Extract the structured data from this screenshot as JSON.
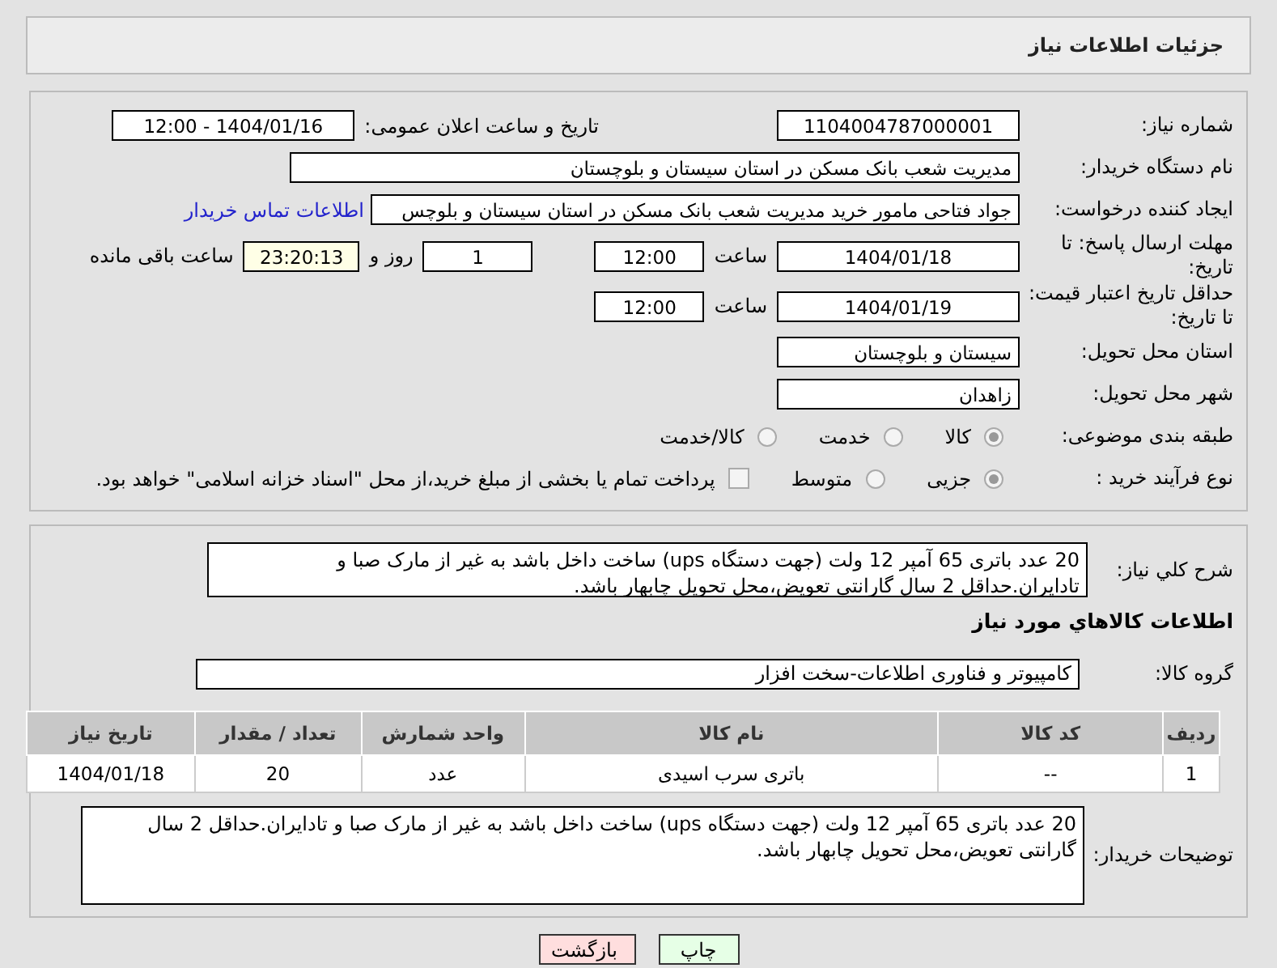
{
  "header": {
    "title": "جزئیات اطلاعات نیاز"
  },
  "details": {
    "need_number": {
      "label": "شماره نیاز:",
      "value": "1104004787000001"
    },
    "announce": {
      "label": "تاریخ و ساعت اعلان عمومی:",
      "value": "1404/01/16 - 12:00"
    },
    "buyer_org": {
      "label": "نام دستگاه خریدار:",
      "value": "مدیریت شعب بانک مسکن در استان سیستان و بلوچستان"
    },
    "requester": {
      "label": "ایجاد کننده درخواست:",
      "value": "جواد  فتاحی مامور خرید مدیریت شعب بانک مسکن در استان سیستان و بلوچس",
      "link": "اطلاعات تماس خریدار"
    },
    "reply_deadline": {
      "label": "مهلت ارسال پاسخ: تا تاریخ:",
      "date": "1404/01/18",
      "time_label": "ساعت",
      "time": "12:00",
      "days": "1",
      "days_label": "روز و",
      "remaining": "23:20:13",
      "remaining_label": "ساعت باقی مانده"
    },
    "price_validity": {
      "label": "حداقل تاریخ اعتبار قیمت: تا تاریخ:",
      "date": "1404/01/19",
      "time_label": "ساعت",
      "time": "12:00"
    },
    "province": {
      "label": "استان محل تحویل:",
      "value": "سیستان و بلوچستان"
    },
    "city": {
      "label": "شهر محل تحویل:",
      "value": "زاهدان"
    },
    "category": {
      "label": "طبقه بندی موضوعی:",
      "options": [
        {
          "label": "کالا",
          "selected": true
        },
        {
          "label": "خدمت",
          "selected": false
        },
        {
          "label": "کالا/خدمت",
          "selected": false
        }
      ]
    },
    "process": {
      "label": "نوع فرآیند خرید :",
      "options": [
        {
          "label": "جزیی",
          "selected": true
        },
        {
          "label": "متوسط",
          "selected": false
        }
      ],
      "treasury": {
        "label": "پرداخت تمام یا بخشی از مبلغ خرید،از محل \"اسناد خزانه اسلامی\" خواهد بود.",
        "checked": false
      }
    }
  },
  "needs": {
    "description": {
      "label": "شرح كلي نياز:",
      "value": "20 عدد باتری 65 آمپر 12 ولت (جهت دستگاه ups) ساخت داخل باشد به غیر از مارک صبا و تادایران.حداقل 2 سال گارانتی تعویض،محل تحویل چابهار باشد."
    },
    "section_title": "اطلاعات كالاهاي مورد نياز",
    "group": {
      "label": "گروه کالا:",
      "value": "کامپیوتر و فناوری اطلاعات-سخت افزار"
    },
    "table": {
      "columns": [
        "ردیف",
        "کد کالا",
        "نام کالا",
        "واحد شمارش",
        "تعداد / مقدار",
        "تاریخ نیاز"
      ],
      "rows": [
        [
          "1",
          "--",
          "باتری سرب اسیدی",
          "عدد",
          "20",
          "1404/01/18"
        ]
      ]
    },
    "buyer_notes": {
      "label": "توضیحات خریدار:",
      "value": "20 عدد باتری 65 آمپر 12 ولت (جهت دستگاه ups) ساخت داخل باشد به غیر از مارک صبا و تادایران.حداقل 2 سال گارانتی تعویض،محل تحویل چابهار باشد."
    }
  },
  "buttons": [
    {
      "label": "چاپ",
      "kind": "print"
    },
    {
      "label": "بازگشت",
      "kind": "back"
    }
  ]
}
